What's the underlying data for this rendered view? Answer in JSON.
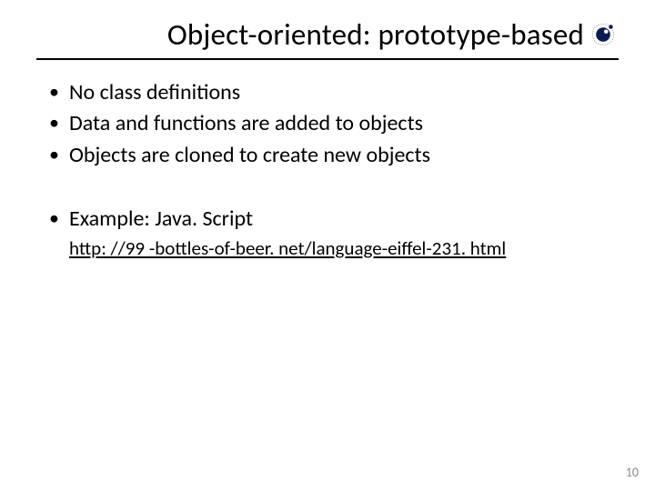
{
  "title": "Object-oriented: prototype-based",
  "bullets_a": [
    "No class definitions",
    "Data and functions are added to objects",
    "Objects are cloned to create new objects"
  ],
  "bullets_b": [
    "Example: Java. Script"
  ],
  "link": "http: //99 -bottles-of-beer. net/language-eiffel-231. html",
  "page_number": "10"
}
